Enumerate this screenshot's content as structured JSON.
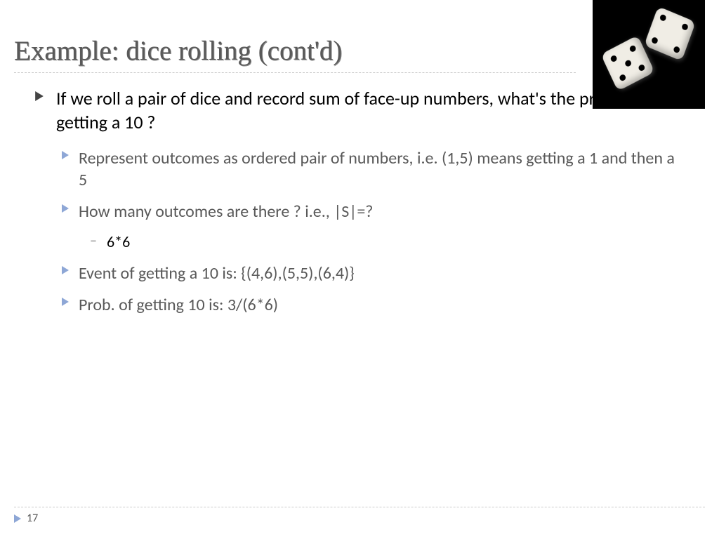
{
  "title": "Example: dice rolling (cont'd)",
  "bullets": {
    "main": "If we roll a pair of dice and record sum of face-up numbers, what's the probability of getting a 10 ?",
    "sub": [
      "Represent outcomes as ordered pair of numbers, i.e. (1,5) means getting a 1 and then a 5",
      "How many outcomes are there ? i.e., |S|=?",
      "Event of getting a 10 is: {(4,6),(5,5),(6,4)}",
      "Prob. of getting 10 is: 3/(6*6)"
    ],
    "subsub": "6*6"
  },
  "pageNumber": "17"
}
